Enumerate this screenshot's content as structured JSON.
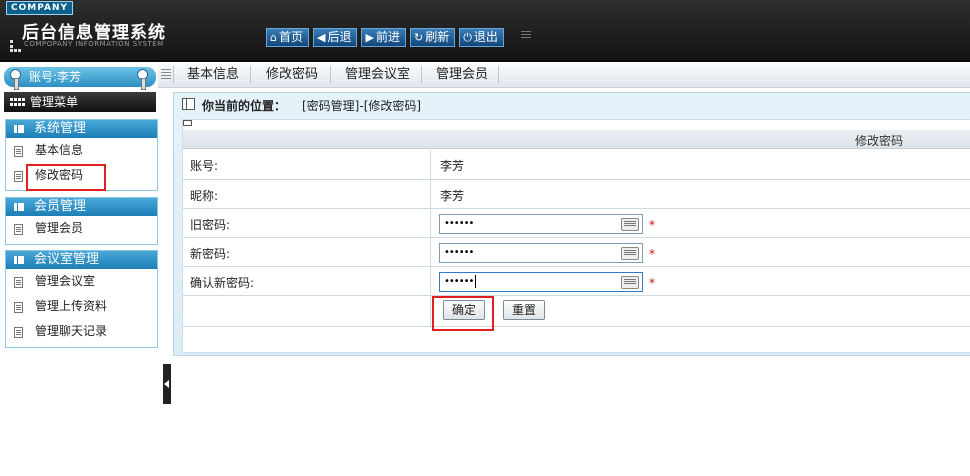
{
  "header": {
    "company_badge": "COMPANY",
    "system_title": "后台信息管理系统",
    "system_subtitle": "COMPOPANY INFORMATION SYSTEM",
    "nav": [
      {
        "label": "首页",
        "icon": "home-icon"
      },
      {
        "label": "后退",
        "icon": "arrow-left-icon"
      },
      {
        "label": "前进",
        "icon": "arrow-right-icon"
      },
      {
        "label": "刷新",
        "icon": "refresh-icon"
      },
      {
        "label": "退出",
        "icon": "power-icon"
      }
    ]
  },
  "sidebar": {
    "account_label": "账号:李芳",
    "menu_title": "管理菜单",
    "groups": [
      {
        "title": "系统管理",
        "items": [
          {
            "label": "基本信息"
          },
          {
            "label": "修改密码",
            "highlighted": true
          }
        ]
      },
      {
        "title": "会员管理",
        "items": [
          {
            "label": "管理会员"
          }
        ]
      },
      {
        "title": "会议室管理",
        "items": [
          {
            "label": "管理会议室"
          },
          {
            "label": "管理上传资料"
          },
          {
            "label": "管理聊天记录"
          }
        ]
      }
    ]
  },
  "tabs": [
    {
      "label": "基本信息"
    },
    {
      "label": "修改密码"
    },
    {
      "label": "管理会议室"
    },
    {
      "label": "管理会员"
    }
  ],
  "location": {
    "prefix": "你当前的位置：",
    "path": "[密码管理]-[修改密码]"
  },
  "form": {
    "header": "修改密码",
    "rows": [
      {
        "label": "账号:",
        "value": "李芳"
      },
      {
        "label": "昵称:",
        "value": "李芳"
      },
      {
        "label": "旧密码:",
        "masked_value": "••••••",
        "required_mark": "*"
      },
      {
        "label": "新密码:",
        "masked_value": "••••••",
        "required_mark": "*"
      },
      {
        "label": "确认新密码:",
        "masked_value": "••••••",
        "required_mark": "*"
      }
    ],
    "confirm_label": "确定",
    "reset_label": "重置"
  },
  "colors": {
    "accent_blue": "#1d7db6",
    "highlight_red": "#e02020",
    "header_dark": "#1a1a1a"
  }
}
